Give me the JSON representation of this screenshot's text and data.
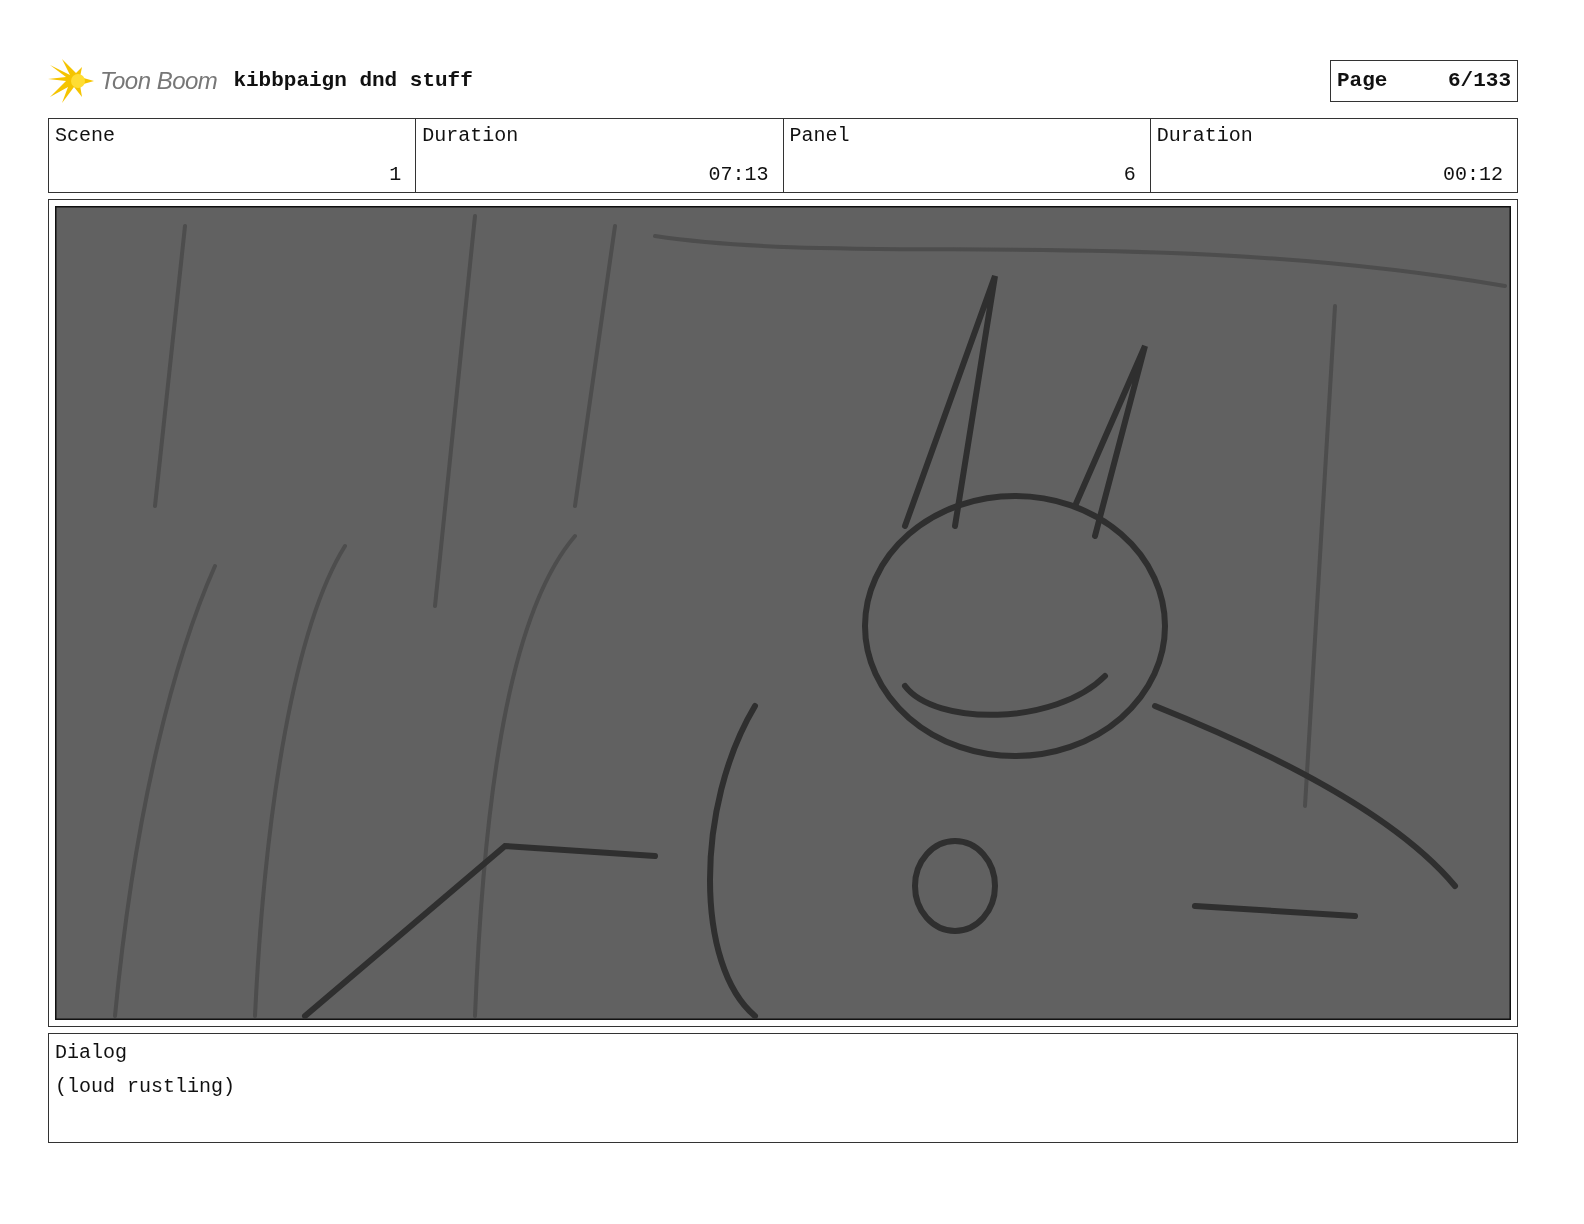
{
  "header": {
    "logo": "Toon Boom",
    "title": "kibbpaign dnd stuff",
    "page_label": "Page",
    "page": "6/133"
  },
  "fields": [
    {
      "label": "Scene",
      "value": "1"
    },
    {
      "label": "Duration",
      "value": "07:13"
    },
    {
      "label": "Panel",
      "value": "6"
    },
    {
      "label": "Duration",
      "value": "00:12"
    }
  ],
  "dialog": {
    "label": "Dialog",
    "text": "(loud rustling)"
  }
}
